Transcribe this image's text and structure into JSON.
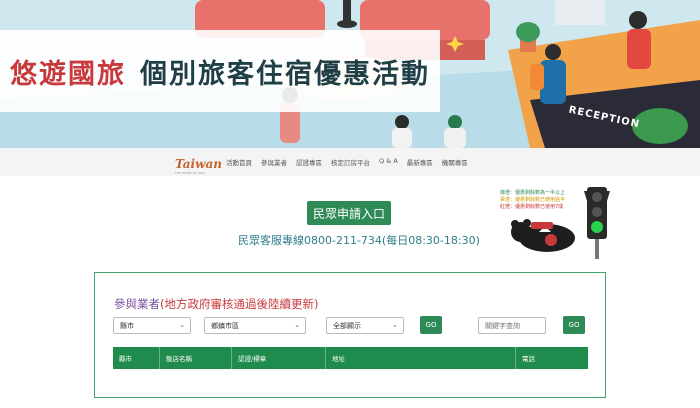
{
  "banner": {
    "title_part1": "悠遊國旅",
    "title_part2": "個別旅客住宿優惠活動",
    "reception_sign": "RECEPTION"
  },
  "nav": {
    "logo": "Taiwan",
    "logo_sub": "THE HEART OF ASIA",
    "items": [
      "活動首頁",
      "參與業者",
      "認證專區",
      "核定訂房平台",
      "Q & A",
      "最新專區",
      "機關專區"
    ]
  },
  "cta": {
    "apply_label": "民眾申請入口",
    "hotline": "民眾客服專線0800-211-734(每日08:30-18:30)"
  },
  "legend": {
    "green": "綠燈：優惠剩餘數為一半以上",
    "yellow": "黃燈：優惠剩餘數已使用過半",
    "red": "紅燈：優惠剩餘數已使用7成"
  },
  "listing": {
    "title_main": "參與業者",
    "title_note": "(地方政府審核通過後陸續更新)",
    "filter_city": "縣市",
    "filter_district": "鄉鎮市區",
    "filter_display": "全部顯示",
    "go_label": "GO",
    "keyword_placeholder": "關鍵字查詢",
    "columns": [
      "縣市",
      "飯店名稱",
      "認證/標章",
      "地址",
      "電話"
    ]
  },
  "colors": {
    "accent_green": "#2e8b57",
    "table_green": "#1f8b4c",
    "title_red": "#c7393b",
    "title_purple": "#7a4fa0",
    "hotline_teal": "#2f7d8c"
  }
}
